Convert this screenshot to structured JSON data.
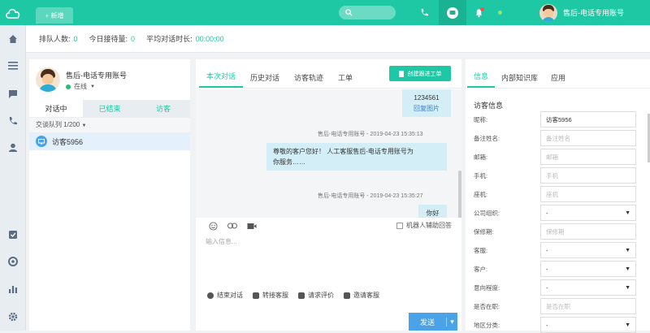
{
  "topbar": {
    "new_tab_label": "+ 新增",
    "user_name": "售后-电话专用账号",
    "accent": "#1ec8a5"
  },
  "stats": {
    "queue_label": "排队人数:",
    "queue_value": "0",
    "today_label": "今日接待量:",
    "today_value": "0",
    "avg_label": "平均对话时长:",
    "avg_value": "00:00:00"
  },
  "left": {
    "agent_name": "售后-电话专用账号",
    "agent_status": "在线",
    "tabs": [
      "对话中",
      "已结束",
      "访客"
    ],
    "queue_label": "交谈队列 1/200",
    "visitor": "访客5956"
  },
  "middle": {
    "tabs": [
      "本次对话",
      "历史对话",
      "访客轨迹",
      "工单"
    ],
    "create_ticket": "创建跟进工单",
    "msg_top_line1": "1234561",
    "msg_top_line2": "回复图片",
    "msg1_meta": "售后-电话专用账号 - 2019-04-23 15:35:13",
    "msg1_text_line1": "尊敬的客户您好！ 人工客服售后-电话专用账号为",
    "msg1_text_line2": "你服务……",
    "msg2_meta": "售后-电话专用账号 - 2019-04-23 15:35:27",
    "msg2_text": "你好",
    "robot_assist": "机器人辅助回答",
    "input_placeholder": "输入信息...",
    "actions": [
      "结束对话",
      "转接客服",
      "请求评价",
      "邀请客服"
    ],
    "send": "发送"
  },
  "right": {
    "tabs": [
      "信息",
      "内部知识库",
      "应用"
    ],
    "heading": "访客信息",
    "fields": [
      {
        "label": "昵称:",
        "value": "访客5956",
        "placeholder": ""
      },
      {
        "label": "备注姓名:",
        "value": "",
        "placeholder": "备注姓名"
      },
      {
        "label": "邮箱:",
        "value": "",
        "placeholder": "邮箱"
      },
      {
        "label": "手机:",
        "value": "",
        "placeholder": "手机"
      },
      {
        "label": "座机:",
        "value": "",
        "placeholder": "座机"
      },
      {
        "label": "公司组织:",
        "value": "-",
        "placeholder": ""
      },
      {
        "label": "保修期:",
        "value": "",
        "placeholder": "保修期"
      },
      {
        "label": "客服:",
        "value": "-",
        "placeholder": ""
      },
      {
        "label": "客户:",
        "value": "-",
        "placeholder": ""
      },
      {
        "label": "意向程度:",
        "value": "-",
        "placeholder": ""
      },
      {
        "label": "是否在职:",
        "value": "",
        "placeholder": "是否在职"
      },
      {
        "label": "地区分类:",
        "value": "-",
        "placeholder": ""
      }
    ]
  }
}
